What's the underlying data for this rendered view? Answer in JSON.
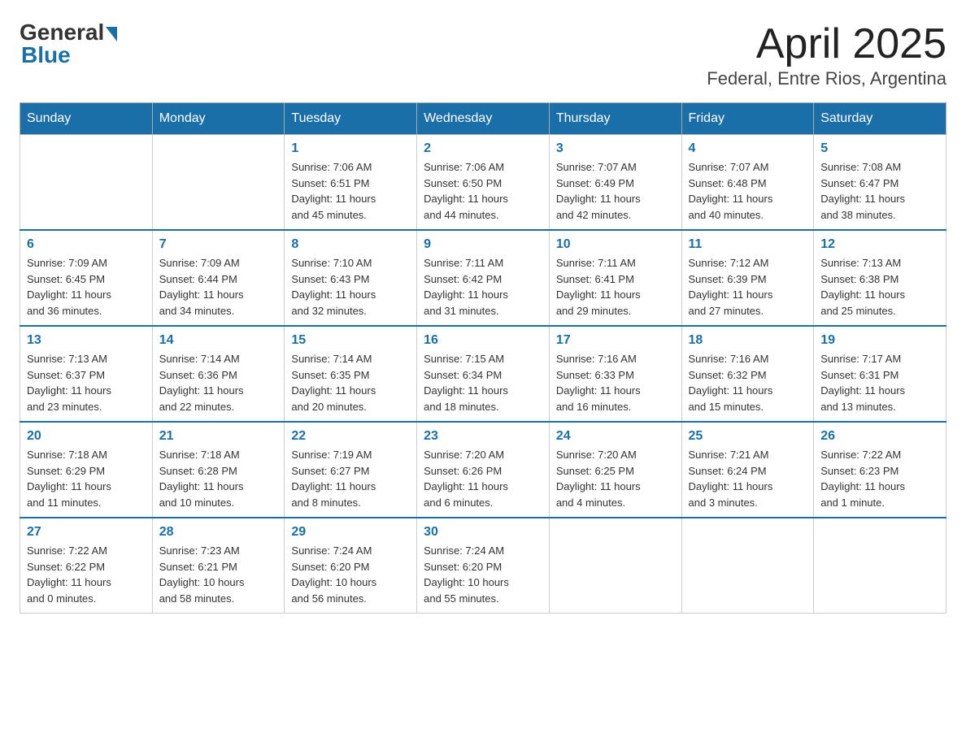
{
  "header": {
    "logo": {
      "general": "General",
      "blue": "Blue"
    },
    "title": "April 2025",
    "subtitle": "Federal, Entre Rios, Argentina"
  },
  "calendar": {
    "days_of_week": [
      "Sunday",
      "Monday",
      "Tuesday",
      "Wednesday",
      "Thursday",
      "Friday",
      "Saturday"
    ],
    "weeks": [
      [
        {
          "day": "",
          "info": ""
        },
        {
          "day": "",
          "info": ""
        },
        {
          "day": "1",
          "info": "Sunrise: 7:06 AM\nSunset: 6:51 PM\nDaylight: 11 hours\nand 45 minutes."
        },
        {
          "day": "2",
          "info": "Sunrise: 7:06 AM\nSunset: 6:50 PM\nDaylight: 11 hours\nand 44 minutes."
        },
        {
          "day": "3",
          "info": "Sunrise: 7:07 AM\nSunset: 6:49 PM\nDaylight: 11 hours\nand 42 minutes."
        },
        {
          "day": "4",
          "info": "Sunrise: 7:07 AM\nSunset: 6:48 PM\nDaylight: 11 hours\nand 40 minutes."
        },
        {
          "day": "5",
          "info": "Sunrise: 7:08 AM\nSunset: 6:47 PM\nDaylight: 11 hours\nand 38 minutes."
        }
      ],
      [
        {
          "day": "6",
          "info": "Sunrise: 7:09 AM\nSunset: 6:45 PM\nDaylight: 11 hours\nand 36 minutes."
        },
        {
          "day": "7",
          "info": "Sunrise: 7:09 AM\nSunset: 6:44 PM\nDaylight: 11 hours\nand 34 minutes."
        },
        {
          "day": "8",
          "info": "Sunrise: 7:10 AM\nSunset: 6:43 PM\nDaylight: 11 hours\nand 32 minutes."
        },
        {
          "day": "9",
          "info": "Sunrise: 7:11 AM\nSunset: 6:42 PM\nDaylight: 11 hours\nand 31 minutes."
        },
        {
          "day": "10",
          "info": "Sunrise: 7:11 AM\nSunset: 6:41 PM\nDaylight: 11 hours\nand 29 minutes."
        },
        {
          "day": "11",
          "info": "Sunrise: 7:12 AM\nSunset: 6:39 PM\nDaylight: 11 hours\nand 27 minutes."
        },
        {
          "day": "12",
          "info": "Sunrise: 7:13 AM\nSunset: 6:38 PM\nDaylight: 11 hours\nand 25 minutes."
        }
      ],
      [
        {
          "day": "13",
          "info": "Sunrise: 7:13 AM\nSunset: 6:37 PM\nDaylight: 11 hours\nand 23 minutes."
        },
        {
          "day": "14",
          "info": "Sunrise: 7:14 AM\nSunset: 6:36 PM\nDaylight: 11 hours\nand 22 minutes."
        },
        {
          "day": "15",
          "info": "Sunrise: 7:14 AM\nSunset: 6:35 PM\nDaylight: 11 hours\nand 20 minutes."
        },
        {
          "day": "16",
          "info": "Sunrise: 7:15 AM\nSunset: 6:34 PM\nDaylight: 11 hours\nand 18 minutes."
        },
        {
          "day": "17",
          "info": "Sunrise: 7:16 AM\nSunset: 6:33 PM\nDaylight: 11 hours\nand 16 minutes."
        },
        {
          "day": "18",
          "info": "Sunrise: 7:16 AM\nSunset: 6:32 PM\nDaylight: 11 hours\nand 15 minutes."
        },
        {
          "day": "19",
          "info": "Sunrise: 7:17 AM\nSunset: 6:31 PM\nDaylight: 11 hours\nand 13 minutes."
        }
      ],
      [
        {
          "day": "20",
          "info": "Sunrise: 7:18 AM\nSunset: 6:29 PM\nDaylight: 11 hours\nand 11 minutes."
        },
        {
          "day": "21",
          "info": "Sunrise: 7:18 AM\nSunset: 6:28 PM\nDaylight: 11 hours\nand 10 minutes."
        },
        {
          "day": "22",
          "info": "Sunrise: 7:19 AM\nSunset: 6:27 PM\nDaylight: 11 hours\nand 8 minutes."
        },
        {
          "day": "23",
          "info": "Sunrise: 7:20 AM\nSunset: 6:26 PM\nDaylight: 11 hours\nand 6 minutes."
        },
        {
          "day": "24",
          "info": "Sunrise: 7:20 AM\nSunset: 6:25 PM\nDaylight: 11 hours\nand 4 minutes."
        },
        {
          "day": "25",
          "info": "Sunrise: 7:21 AM\nSunset: 6:24 PM\nDaylight: 11 hours\nand 3 minutes."
        },
        {
          "day": "26",
          "info": "Sunrise: 7:22 AM\nSunset: 6:23 PM\nDaylight: 11 hours\nand 1 minute."
        }
      ],
      [
        {
          "day": "27",
          "info": "Sunrise: 7:22 AM\nSunset: 6:22 PM\nDaylight: 11 hours\nand 0 minutes."
        },
        {
          "day": "28",
          "info": "Sunrise: 7:23 AM\nSunset: 6:21 PM\nDaylight: 10 hours\nand 58 minutes."
        },
        {
          "day": "29",
          "info": "Sunrise: 7:24 AM\nSunset: 6:20 PM\nDaylight: 10 hours\nand 56 minutes."
        },
        {
          "day": "30",
          "info": "Sunrise: 7:24 AM\nSunset: 6:20 PM\nDaylight: 10 hours\nand 55 minutes."
        },
        {
          "day": "",
          "info": ""
        },
        {
          "day": "",
          "info": ""
        },
        {
          "day": "",
          "info": ""
        }
      ]
    ]
  }
}
